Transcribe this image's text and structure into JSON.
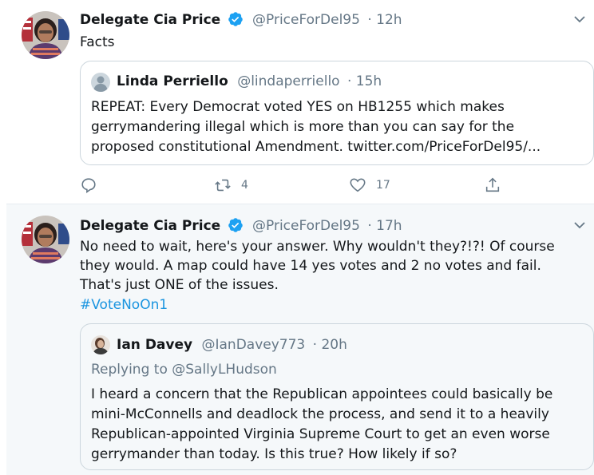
{
  "tweet1": {
    "name": "Delegate Cia Price",
    "handle": "@PriceForDel95",
    "time": "· 12h",
    "text": "Facts",
    "quoted": {
      "name": "Linda Perriello",
      "handle": "@lindaperriello",
      "time": "· 15h",
      "text": "REPEAT: Every Democrat voted YES on HB1255 which makes gerrymandering illegal which is more than you can say for the proposed constitutional Amendment. twitter.com/PriceForDel95/..."
    },
    "actions": {
      "replies": "",
      "retweets": "4",
      "likes": "17"
    }
  },
  "tweet2": {
    "name": "Delegate Cia Price",
    "handle": "@PriceForDel95",
    "time": "· 17h",
    "text": "No need to wait, here's your answer. Why wouldn't they?!?! Of course they would. A map could have 14 yes votes and 2 no votes and fail. That's just ONE of the issues.",
    "hashtag": "#VoteNoOn1",
    "quoted": {
      "name": "Ian Davey",
      "handle": "@IanDavey773",
      "time": "· 20h",
      "replying_to": "Replying to @SallyLHudson",
      "text": "I heard a concern that the Republican appointees could basically be mini-McConnells and deadlock the process, and send it to a heavily Republican-appointed Virginia Supreme Court to get an even worse gerrymander than today.  Is this true?  How likely if so?"
    }
  },
  "colors": {
    "accent": "#1da1f2",
    "hashtag": "#1b95e0",
    "secondary_text": "#657786",
    "border": "#ccd6dd",
    "selected_bg": "#f5f8fa"
  }
}
